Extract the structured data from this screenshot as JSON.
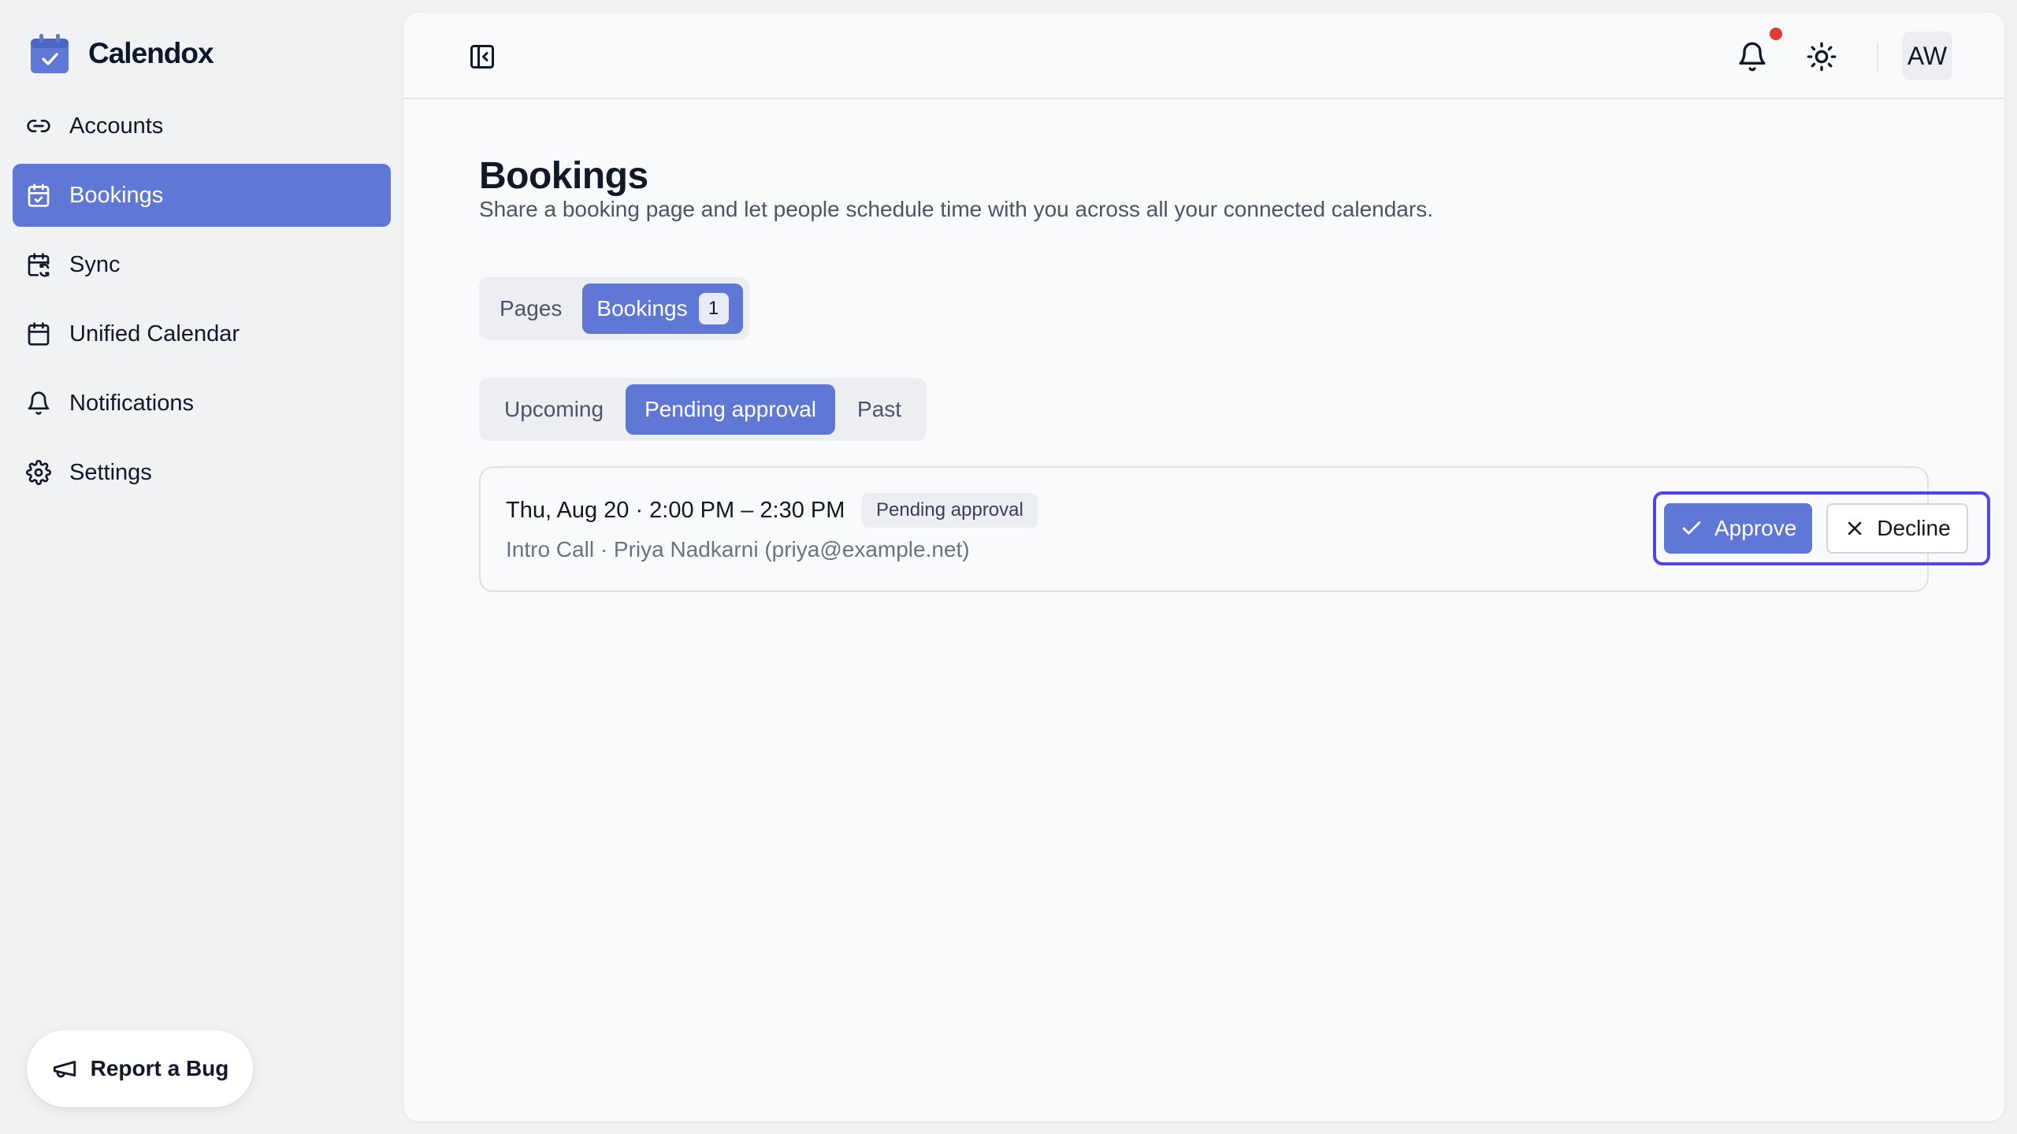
{
  "app": {
    "name": "Calendox"
  },
  "sidebar": {
    "items": [
      {
        "label": "Accounts",
        "icon": "link-icon"
      },
      {
        "label": "Bookings",
        "icon": "calendar-check-icon",
        "active": true
      },
      {
        "label": "Sync",
        "icon": "calendar-sync-icon"
      },
      {
        "label": "Unified Calendar",
        "icon": "calendar-icon"
      },
      {
        "label": "Notifications",
        "icon": "bell-icon"
      },
      {
        "label": "Settings",
        "icon": "gear-icon"
      }
    ],
    "report_bug_label": "Report a Bug"
  },
  "topbar": {
    "avatar_initials": "AW",
    "has_unread_notifications": true
  },
  "page": {
    "title": "Bookings",
    "subtitle": "Share a booking page and let people schedule time with you across all your connected calendars."
  },
  "tabs": {
    "main": [
      {
        "label": "Pages",
        "active": false
      },
      {
        "label": "Bookings",
        "active": true,
        "count": "1"
      }
    ],
    "sub": [
      {
        "label": "Upcoming",
        "active": false
      },
      {
        "label": "Pending approval",
        "active": true
      },
      {
        "label": "Past",
        "active": false
      }
    ]
  },
  "booking": {
    "when": "Thu, Aug 20 · 2:00 PM – 2:30 PM",
    "status": "Pending approval",
    "detail": "Intro Call · Priya Nadkarni (priya@example.net)",
    "approve_label": "Approve",
    "decline_label": "Decline"
  },
  "colors": {
    "accent": "#5f78d6",
    "focus_ring": "#4f46e5",
    "notification_dot": "#e53935"
  }
}
